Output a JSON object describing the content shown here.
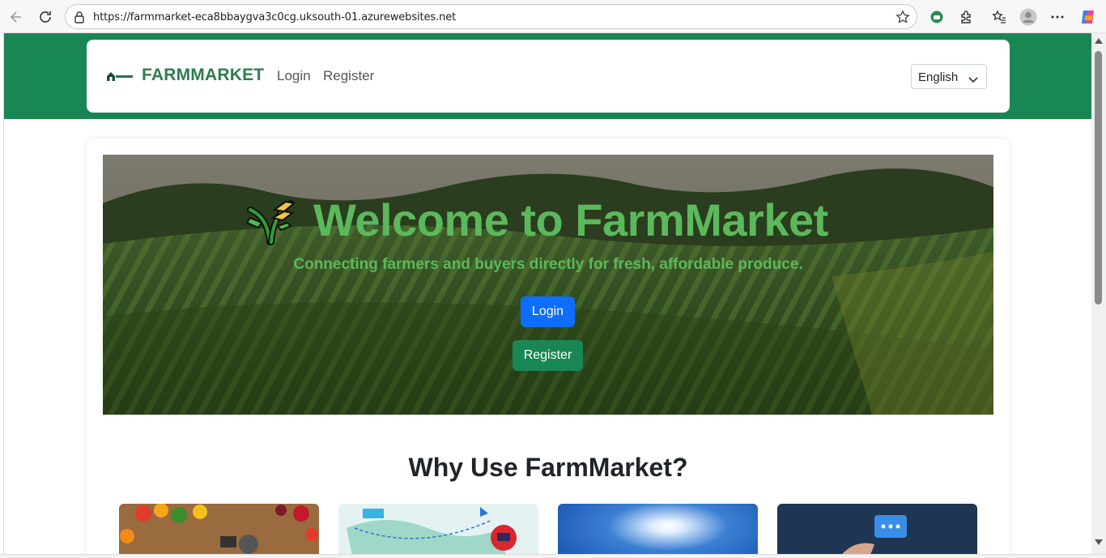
{
  "browser": {
    "url": "https://farmmarket-eca8bbaygva3c0cg.uksouth-01.azurewebsites.net",
    "icons": [
      "back-icon",
      "refresh-icon",
      "lock-icon",
      "star-icon",
      "copilot-extension-icon",
      "puzzle-icon",
      "favorites-icon",
      "profile-icon",
      "more-icon",
      "copilot-icon"
    ]
  },
  "navbar": {
    "brand": "FARMMARKET",
    "links": [
      "Login",
      "Register"
    ],
    "language": "English"
  },
  "hero": {
    "title": "Welcome to FarmMarket",
    "subtitle": "Connecting farmers and buyers directly for fresh, affordable produce.",
    "login_label": "Login",
    "register_label": "Register"
  },
  "features": {
    "title": "Why Use FarmMarket?"
  },
  "colors": {
    "brand_green": "#198754",
    "hero_text": "#5cb85c",
    "primary_blue": "#0d6efd"
  }
}
